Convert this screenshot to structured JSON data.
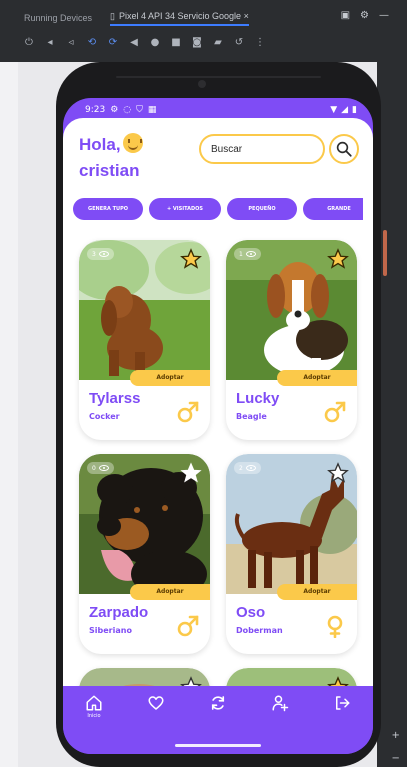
{
  "ide": {
    "tabs": [
      {
        "label": "Running Devices"
      },
      {
        "label": "Pixel 4 API 34 Servicio Google",
        "close": "×"
      }
    ],
    "window_icons": [
      "layout-icon",
      "gear-icon",
      "minimize-icon"
    ],
    "toolbar_icons": [
      "power-icon",
      "volume-up-icon",
      "volume-down-icon",
      "rotate-left-icon",
      "rotate-right-icon",
      "back-icon",
      "home-icon",
      "overview-icon",
      "screenshot-icon",
      "camera-icon",
      "undo-icon",
      "more-icon"
    ]
  },
  "status_bar": {
    "time": "9:23"
  },
  "header": {
    "greeting_line1": "Hola,",
    "greeting_line2": "cristian",
    "search_placeholder": "Buscar"
  },
  "chips": [
    {
      "label": "GENERA TUPO"
    },
    {
      "label": "+ VISITADOS"
    },
    {
      "label": "PEQUEÑO"
    },
    {
      "label": "GRANDE"
    }
  ],
  "cards": [
    {
      "views": "3",
      "name": "Tylarss",
      "breed": "Cocker",
      "adopt_label": "Adoptar",
      "gender": "male",
      "favorite": true
    },
    {
      "views": "1",
      "name": "Lucky",
      "breed": "Beagle",
      "adopt_label": "Adoptar",
      "gender": "male",
      "favorite": true
    },
    {
      "views": "0",
      "name": "Zarpado",
      "breed": "Siberiano",
      "adopt_label": "Adoptar",
      "gender": "male",
      "favorite": false
    },
    {
      "views": "2",
      "name": "Oso",
      "breed": "Doberman",
      "adopt_label": "Adoptar",
      "gender": "female",
      "favorite": false
    }
  ],
  "nav": {
    "items": [
      {
        "icon": "home-icon",
        "label": "Inicio"
      },
      {
        "icon": "heart-icon",
        "label": ""
      },
      {
        "icon": "refresh-icon",
        "label": ""
      },
      {
        "icon": "user-add-icon",
        "label": ""
      },
      {
        "icon": "logout-icon",
        "label": ""
      }
    ]
  },
  "colors": {
    "accent": "#7f4cf5",
    "highlight": "#fbc94a"
  }
}
